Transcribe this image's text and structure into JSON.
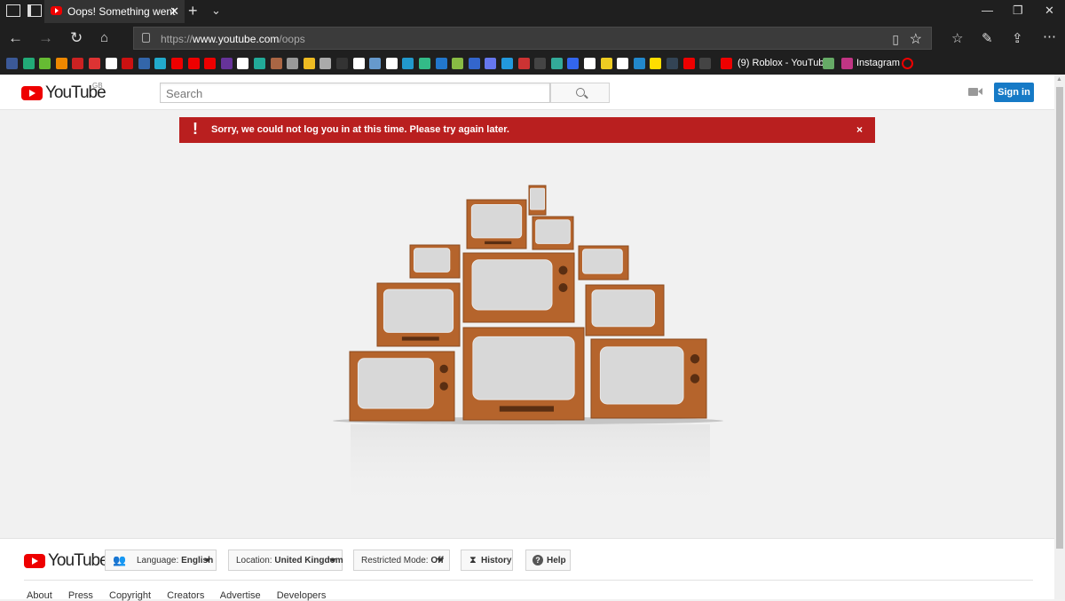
{
  "browser": {
    "tab_title": "Oops! Something went",
    "tab_close": "✕",
    "new_tab": "+",
    "url_prefix": "https://",
    "url_host": "www.youtube.com",
    "url_path": "/oops"
  },
  "bookmarks": {
    "roblox_label": "(9) Roblox - YouTube",
    "instagram_label": "Instagram"
  },
  "header": {
    "logo_text": "YouTube",
    "region": "GB",
    "search_placeholder": "Search",
    "sign_in": "Sign in"
  },
  "alert": {
    "message": "Sorry, we could not log you in at this time. Please try again later.",
    "icon": "!",
    "close": "×"
  },
  "footer": {
    "logo_text": "YouTube",
    "language_label": "Language:",
    "language_value": "English",
    "location_label": "Location:",
    "location_value": "United Kingdom",
    "restricted_label": "Restricted Mode:",
    "restricted_value": "Off",
    "history": "History",
    "help": "Help",
    "links": [
      "About",
      "Press",
      "Copyright",
      "Creators",
      "Advertise",
      "Developers"
    ]
  },
  "colors": {
    "accent_red": "#b91f1f",
    "youtube_red": "#ee0000",
    "signin_blue": "#167ac6",
    "tv_wood": "#b5642c"
  },
  "icons": [
    "tab-list-icon",
    "back-icon",
    "forward-icon",
    "refresh-icon",
    "home-icon",
    "lock-icon",
    "reading-view-icon",
    "favorite-star-icon",
    "favorites-icon",
    "pen-icon",
    "share-icon",
    "more-icon",
    "search-icon",
    "upload-camera-icon",
    "history-icon",
    "help-icon",
    "language-icon"
  ]
}
